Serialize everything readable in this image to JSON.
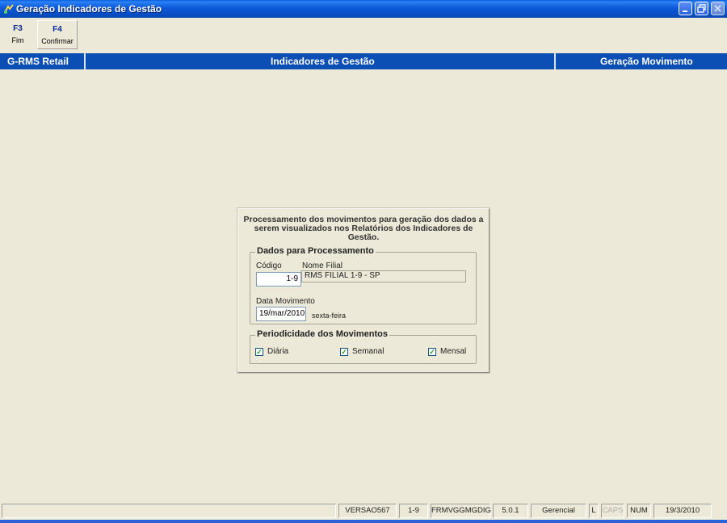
{
  "window": {
    "title": "Geração Indicadores de Gestão",
    "icon": "app-icon",
    "controls": [
      "minimize-icon",
      "restore-icon",
      "close-icon"
    ]
  },
  "toolbar": {
    "f3_key": "F3",
    "f3_label": "Fim",
    "f4_key": "F4",
    "f4_label": "Confirmar"
  },
  "header": {
    "left": "G-RMS Retail",
    "center": "Indicadores de Gestão",
    "right": "Geração Movimento"
  },
  "panel": {
    "description": "Processamento dos movimentos para geração dos dados a serem visualizados nos Relatórios dos Indicadores de Gestão.",
    "dados": {
      "legend": "Dados para Processamento",
      "codigo_label": "Código",
      "codigo_value": "1-9",
      "nome_label": "Nome Filial",
      "nome_value": "RMS FILIAL 1-9 - SP",
      "data_label": "Data Movimento",
      "data_value": "19/mar/2010",
      "weekday": "sexta-feira"
    },
    "periodicidade": {
      "legend": "Periodicidade dos Movimentos",
      "options": [
        {
          "label": "Diária",
          "checked": true
        },
        {
          "label": "Semanal",
          "checked": true
        },
        {
          "label": "Mensal",
          "checked": true
        }
      ]
    }
  },
  "statusbar": {
    "items": [
      "VERSAO567",
      "1-9",
      "FRMVGGMGDIG",
      "5.0.1",
      "Gerencial",
      "L",
      "CAPS",
      "NUM",
      "19/3/2010"
    ]
  },
  "colors": {
    "titlebar": "#0c58d8",
    "band": "#0b4fb5",
    "window_bg": "#ece9d8"
  }
}
